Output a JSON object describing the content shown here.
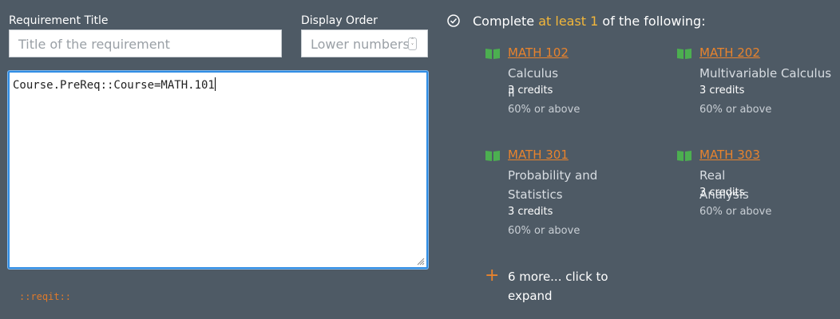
{
  "form": {
    "title_label": "Requirement Title",
    "title_placeholder": "Title of the requirement",
    "order_label": "Display Order",
    "order_placeholder": "Lower numbers",
    "expression": "Course.PreReq::Course=MATH.101",
    "tag": "::reqit::"
  },
  "requirement": {
    "heading_pre": "Complete ",
    "heading_highlight": "at least 1",
    "heading_post": " of the following:",
    "courses": [
      {
        "code": "MATH 102",
        "name": "Calculus II",
        "credits": "3 credits",
        "grade": "60% or above"
      },
      {
        "code": "MATH 202",
        "name": "Multivariable Calculus",
        "credits": "3 credits",
        "grade": "60% or above"
      },
      {
        "code": "MATH 301",
        "name": "Probability and Statistics",
        "credits": "3 credits",
        "grade": "60% or above"
      },
      {
        "code": "MATH 303",
        "name": "Real Analysis",
        "credits": "3 credits",
        "grade": "60% or above"
      }
    ],
    "more_label": "6 more... click to expand"
  },
  "colors": {
    "background": "#4e5a65",
    "accent": "#e8832d",
    "highlight": "#f3b73a",
    "book": "#4caf50"
  },
  "icons": {
    "check": "check-circle-icon",
    "book": "book-icon",
    "plus": "plus-icon"
  }
}
